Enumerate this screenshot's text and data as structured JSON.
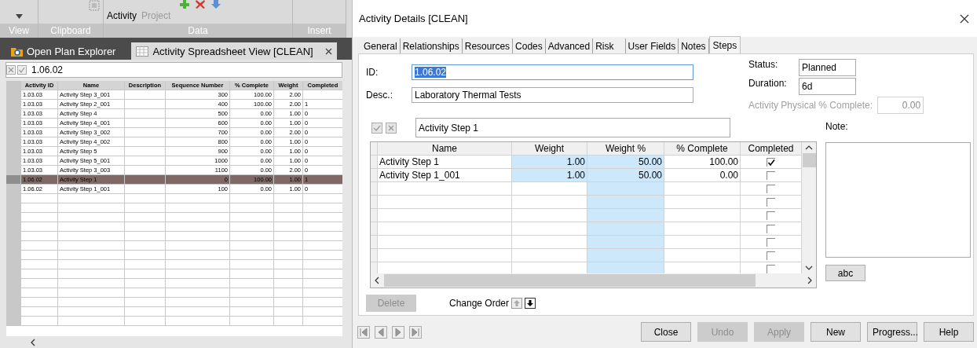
{
  "ribbon": {
    "buttons": [
      {
        "label": "Activity",
        "disabled": false
      },
      {
        "label": "Project",
        "disabled": true
      }
    ],
    "groups": [
      "View",
      "Clipboard",
      "Data",
      "Insert"
    ]
  },
  "doc_tabs": [
    {
      "label": "Open Plan Explorer",
      "kind": "explorer",
      "selected": false
    },
    {
      "label": "Activity Spreadsheet View [CLEAN]",
      "kind": "sheet",
      "selected": true
    }
  ],
  "edit_bar": {
    "value": "1.06.02"
  },
  "spreadsheet": {
    "columns": [
      "Activity ID",
      "Name",
      "Description",
      "Sequence Number",
      "% Complete",
      "Weight",
      "Completed"
    ],
    "rows": [
      {
        "activity_id": "1.03.03",
        "name": "Activity Step 3_001",
        "sequence_number": "300",
        "percent_complete": "100.00",
        "weight": "2.00",
        "selected": false
      },
      {
        "activity_id": "1.03.03",
        "name": "Activity Step 2_001",
        "sequence_number": "400",
        "percent_complete": "100.00",
        "weight": "2.00",
        "completed": "1",
        "selected": false
      },
      {
        "activity_id": "1.03.03",
        "name": "Activity Step 4",
        "sequence_number": "500",
        "percent_complete": "0.00",
        "weight": "1.00",
        "completed": "0",
        "selected": false
      },
      {
        "activity_id": "1.03.03",
        "name": "Activity Step 4_001",
        "sequence_number": "600",
        "percent_complete": "0.00",
        "weight": "1.00",
        "completed": "0",
        "selected": false
      },
      {
        "activity_id": "1.03.03",
        "name": "Activity Step 3_002",
        "sequence_number": "700",
        "percent_complete": "0.00",
        "weight": "2.00",
        "completed": "0",
        "selected": false
      },
      {
        "activity_id": "1.03.03",
        "name": "Activity Step 4_002",
        "sequence_number": "800",
        "percent_complete": "0.00",
        "weight": "1.00",
        "completed": "0",
        "selected": false
      },
      {
        "activity_id": "1.03.03",
        "name": "Activity Step 5",
        "sequence_number": "900",
        "percent_complete": "0.00",
        "weight": "1.00",
        "completed": "0",
        "selected": false
      },
      {
        "activity_id": "1.03.03",
        "name": "Activity Step 5_001",
        "sequence_number": "1000",
        "percent_complete": "0.00",
        "weight": "1.00",
        "completed": "0",
        "selected": false
      },
      {
        "activity_id": "1.03.03",
        "name": "Activity Step 3_003",
        "sequence_number": "1100",
        "percent_complete": "0.00",
        "weight": "2.00",
        "completed": "0",
        "selected": false
      },
      {
        "activity_id": "1.06.02",
        "name": "Activity Step 1",
        "sequence_number": "0",
        "percent_complete": "100.00",
        "weight": "1.00",
        "completed": "1",
        "selected": true
      },
      {
        "activity_id": "1.06.02",
        "name": "Activity Step 1_001",
        "sequence_number": "100",
        "percent_complete": "0.00",
        "weight": "1.00",
        "completed": "0",
        "selected": false
      }
    ]
  },
  "dialog": {
    "title": "Activity Details [CLEAN]",
    "tabs": [
      {
        "label": "General",
        "selected": false
      },
      {
        "label": "Relationships",
        "selected": false
      },
      {
        "label": "Resources",
        "selected": false
      },
      {
        "label": "Codes",
        "selected": false
      },
      {
        "label": "Advanced",
        "selected": false
      },
      {
        "label": "Risk",
        "selected": false
      },
      {
        "label": "User Fields",
        "selected": false
      },
      {
        "label": "Notes",
        "selected": false
      },
      {
        "label": "Steps",
        "selected": true
      }
    ],
    "id": {
      "label": "ID:",
      "value": "1.06.02",
      "value_selected": true
    },
    "desc": {
      "label": "Desc.:",
      "value": "Laboratory Thermal Tests"
    },
    "status": {
      "label": "Status:",
      "value": "Planned"
    },
    "duration": {
      "label": "Duration:",
      "value": "6d"
    },
    "physical": {
      "label": "Activity Physical % Complete:",
      "value": "0.00",
      "disabled": true
    },
    "step_name": "Activity Step 1",
    "note_label": "Note:",
    "steps": {
      "columns": [
        {
          "label": "Name"
        },
        {
          "label": "Weight",
          "highlighted": true,
          "highlight_empty": false
        },
        {
          "label": "Weight %",
          "highlighted": true,
          "highlight_empty": true
        },
        {
          "label": "% Complete"
        },
        {
          "label": "Completed"
        }
      ],
      "rows": [
        {
          "name": "Activity Step 1",
          "weight": "1.00",
          "weight_percent": "50.00",
          "percent_complete": "100.00",
          "completed": true
        },
        {
          "name": "Activity Step 1_001",
          "weight": "1.00",
          "weight_percent": "50.00",
          "percent_complete": "0.00",
          "completed": false
        },
        {
          "completed": false
        },
        {
          "completed": false
        },
        {
          "completed": false
        },
        {
          "completed": false
        },
        {
          "completed": false
        },
        {
          "completed": false
        },
        {
          "completed": false
        }
      ]
    },
    "delete_button": {
      "label": "Delete",
      "disabled": true
    },
    "change_order": "Change Order",
    "abc_button": "abc",
    "buttons": [
      {
        "label": "Close",
        "disabled": false
      },
      {
        "label": "Undo",
        "disabled": true
      },
      {
        "label": "Apply",
        "disabled": true
      },
      {
        "label": "New",
        "disabled": false
      },
      {
        "label": "Progress...",
        "disabled": false
      },
      {
        "label": "Help",
        "disabled": false
      }
    ]
  }
}
